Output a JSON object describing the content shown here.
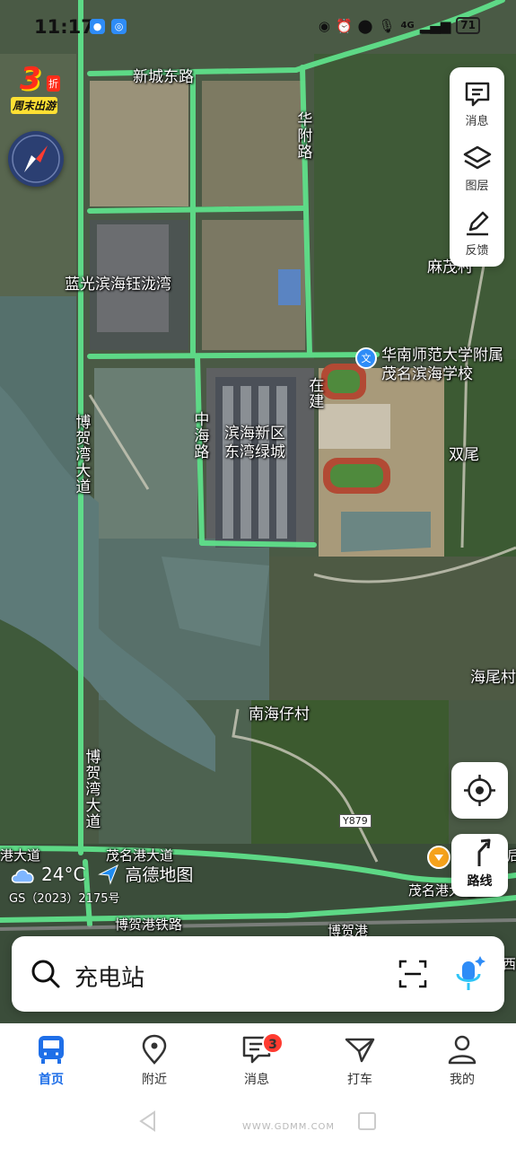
{
  "status_bar": {
    "time": "11:17",
    "battery": "71",
    "network": "4G"
  },
  "promo": {
    "number": "3",
    "discount": "折",
    "subtitle": "周末出游"
  },
  "tools": [
    {
      "label": "消息",
      "icon": "message-icon"
    },
    {
      "label": "图层",
      "icon": "layers-icon"
    },
    {
      "label": "反馈",
      "icon": "feedback-icon"
    }
  ],
  "map_labels": {
    "xincheng_road": "新城东路",
    "huafu_road": "华附路",
    "langguang": "蓝光滨海钰泷湾",
    "maowucun": "麻茂村",
    "school": "华南师范大学附属茂名滨海学校",
    "zaijian": "在建",
    "zhonghai_road": "中海路",
    "binhai": "滨海新区东湾绿城",
    "bohewan_road": "博贺湾大道",
    "shuangwei": "双尾",
    "haiweicun": "海尾村",
    "nanhaizai": "南海仔村",
    "y879": "Y879",
    "maominggang": "茂名港大道",
    "maominggang2": "茂名港大道",
    "bohegang_rail": "博贺港铁路",
    "left_road_fragment": "港大道",
    "right_fragment": "后",
    "bottom_fragment": "博贺港",
    "right_fragment2": "西"
  },
  "weather": {
    "temperature": "24°C",
    "brand": "高德地图"
  },
  "approval": "GS（2023）2175号",
  "route_button": {
    "label": "路线"
  },
  "search": {
    "placeholder": "充电站"
  },
  "bottom_nav": [
    {
      "label": "首页",
      "icon": "bus-icon",
      "active": true
    },
    {
      "label": "附近",
      "icon": "location-pin-icon",
      "active": false
    },
    {
      "label": "消息",
      "icon": "chat-icon",
      "active": false,
      "badge": "3"
    },
    {
      "label": "打车",
      "icon": "taxi-icon",
      "active": false
    },
    {
      "label": "我的",
      "icon": "profile-icon",
      "active": false
    }
  ],
  "watermark": "WWW.GDMM.COM",
  "colors": {
    "road": "#5fe08a",
    "accent": "#1f6fe8",
    "badge": "#ff3b30"
  }
}
